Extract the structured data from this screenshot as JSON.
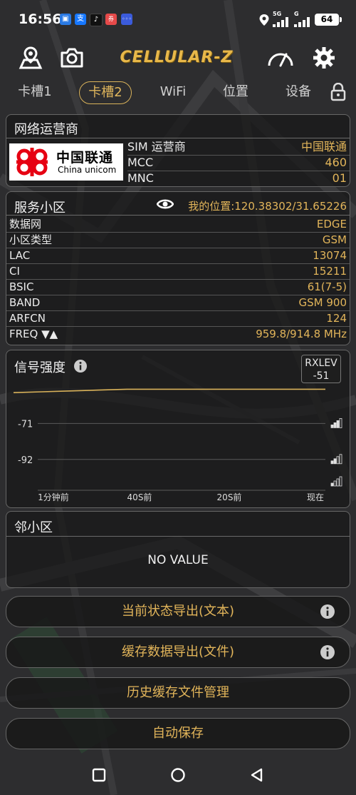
{
  "status": {
    "time": "16:56",
    "battery": "64",
    "net_5g": "5G",
    "net_g": "G"
  },
  "toolbar": {
    "app_title": "CELLULAR-Z"
  },
  "tabs": [
    {
      "label": "卡槽1",
      "active": false
    },
    {
      "label": "卡槽2",
      "active": true
    },
    {
      "label": "WiFi",
      "active": false
    },
    {
      "label": "位置",
      "active": false
    },
    {
      "label": "设备",
      "active": false
    }
  ],
  "operator": {
    "title": "网络运营商",
    "logo_cn": "中国联通",
    "logo_en": "China unicom",
    "rows": [
      {
        "key": "SIM 运营商",
        "value": "中国联通"
      },
      {
        "key": "MCC",
        "value": "460"
      },
      {
        "key": "MNC",
        "value": "01"
      }
    ]
  },
  "cell": {
    "title": "服务小区",
    "position": "我的位置:120.38302/31.65226",
    "rows": [
      {
        "key": "数据网",
        "value": "EDGE"
      },
      {
        "key": "小区类型",
        "value": "GSM"
      },
      {
        "key": "LAC",
        "value": "13074"
      },
      {
        "key": "CI",
        "value": "15211"
      },
      {
        "key": "BSIC",
        "value": "61(7-5)"
      },
      {
        "key": "BAND",
        "value": "GSM 900"
      },
      {
        "key": "ARFCN",
        "value": "124"
      },
      {
        "key": "FREQ ▼▲",
        "value": "959.8/914.8 MHz"
      }
    ]
  },
  "signal": {
    "title": "信号强度",
    "rxlev_label": "RXLEV",
    "rxlev_value": "-51"
  },
  "chart_data": {
    "type": "line",
    "title": "",
    "xlabel": "",
    "ylabel": "",
    "y_tick_labels": [
      "-71",
      "-92"
    ],
    "x_tick_labels": [
      "1分钟前",
      "40S前",
      "20S前",
      "现在"
    ],
    "ylim": [
      -110,
      -45
    ],
    "series": [
      {
        "values": [
          -53,
          -52.5,
          -52,
          -51.5,
          -51,
          -51,
          -51,
          -51,
          -51,
          -51,
          -51,
          -51
        ],
        "color": "#d9b25a"
      }
    ],
    "grid": true
  },
  "neighbors": {
    "title": "邻小区",
    "empty_text": "NO VALUE"
  },
  "buttons": [
    {
      "label": "当前状态导出(文本)",
      "info": true
    },
    {
      "label": "缓存数据导出(文件)",
      "info": true
    },
    {
      "label": "历史缓存文件管理",
      "info": false
    },
    {
      "label": "自动保存",
      "info": false
    }
  ],
  "colors": {
    "accent": "#e2b55a",
    "card_bg": "#181818",
    "border": "#666666"
  }
}
